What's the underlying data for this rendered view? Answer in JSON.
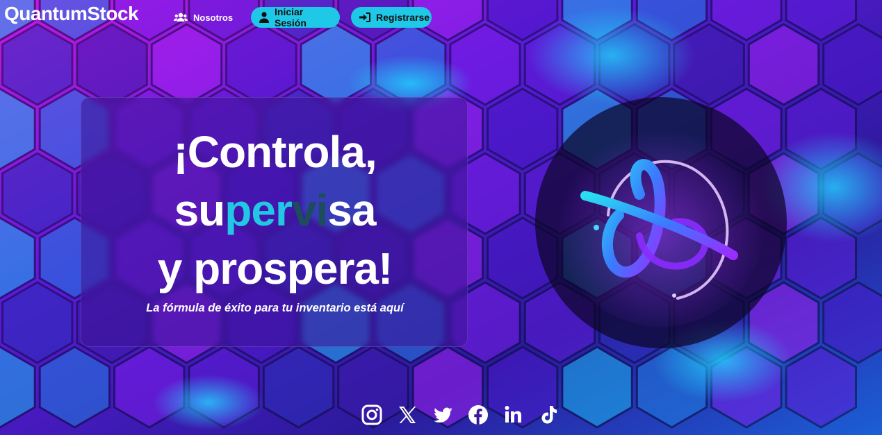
{
  "nav": {
    "brand": "QuantumStock",
    "links": [
      {
        "label": "Nosotros",
        "icon": "users-icon"
      },
      {
        "label": "Iniciar Sesión",
        "icon": "user-icon"
      },
      {
        "label": "Registrarse",
        "icon": "sign-in-icon"
      }
    ]
  },
  "hero": {
    "line1": "¡Controla,",
    "line2_a": "su",
    "line2_b": "per",
    "line2_c": "vi",
    "line2_d": "sa",
    "line3": "y prospera!",
    "tagline": "La fórmula de éxito para tu inventario está aquí"
  },
  "logo": {
    "icon": "quantum-orbit-logo"
  },
  "socials": [
    "instagram-icon",
    "x-icon",
    "twitter-icon",
    "facebook-icon",
    "linkedin-icon",
    "tiktok-icon"
  ],
  "colors": {
    "accent": "#1ec8e6",
    "accent_dark": "#1d4d5c",
    "purple": "#6a1ee0",
    "magenta": "#d81cf0"
  }
}
